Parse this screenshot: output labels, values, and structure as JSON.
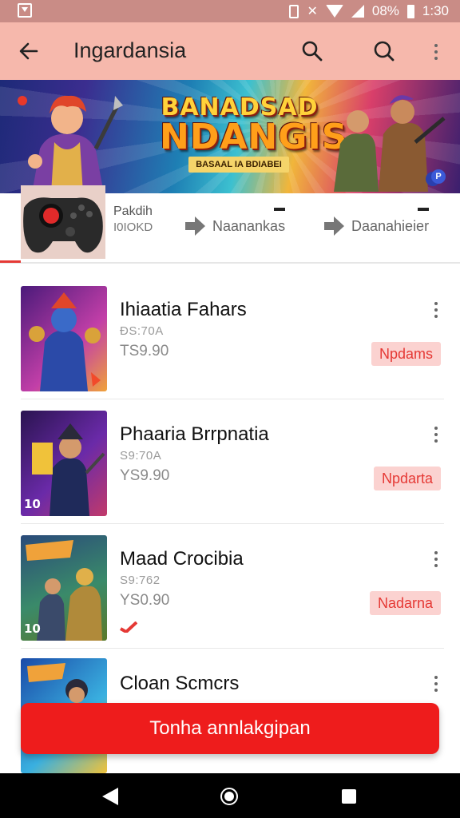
{
  "status_bar": {
    "battery": "08%",
    "time": "1:30"
  },
  "app_bar": {
    "title": "Ingardansia"
  },
  "banner": {
    "title_line1": "BANADSAD",
    "title_line2": "NDANGIS",
    "subtitle": "BASAAL IA BDIABEI"
  },
  "tabs": {
    "controller_label_top": "Pakdih",
    "controller_label_bottom": "I0IOKD",
    "nav1_label": "Naanankas",
    "nav2_label": "Daanahieier"
  },
  "items": [
    {
      "title": "Ihiaatia Fahars",
      "meta": "ĐS:70A",
      "price": "TS9.90",
      "tag": "Npdams",
      "badge": ""
    },
    {
      "title": "Phaaria Brrpnatia",
      "meta": "S9:70A",
      "price": "YS9.90",
      "tag": "Npdarta",
      "badge": "10"
    },
    {
      "title": "Maad Crocibia",
      "meta": "S9:762",
      "price": "YS0.90",
      "tag": "Nadarna",
      "badge": "10"
    },
    {
      "title": "Cloan Scmcrs",
      "meta": "",
      "price": "",
      "tag": "",
      "badge": ""
    }
  ],
  "cta_label": "Tonha annlakgipan",
  "colors": {
    "accent": "#ee1c1c",
    "app_bar": "#f6b8ac",
    "status_bar": "#c98c86",
    "tag_bg": "#fbd2d0"
  }
}
